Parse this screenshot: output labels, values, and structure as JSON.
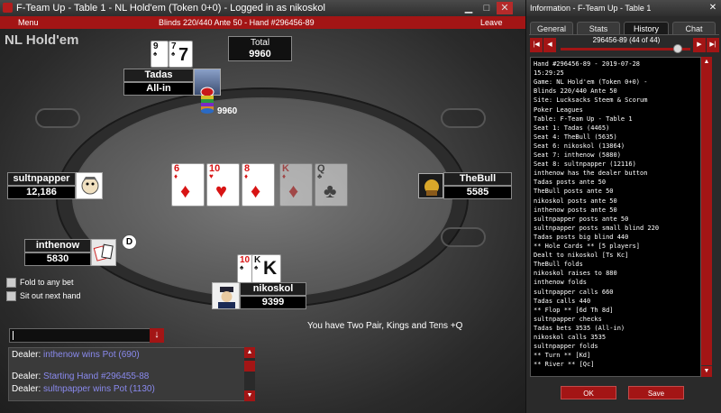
{
  "game_window": {
    "title": "F-Team Up - Table 1 - NL Hold'em (Token 0+0) - Logged in as nikoskol",
    "menu_label": "Menu",
    "blinds_text": "Blinds 220/440 Ante 50 - Hand #296456-89",
    "leave_label": "Leave",
    "game_name": "NL Hold'em"
  },
  "pot": {
    "label": "Total",
    "value": "9960"
  },
  "chip_stack_value": "9960",
  "dealer_button": "D",
  "board": [
    {
      "rank": "6",
      "suit": "♦",
      "color": "red",
      "dim": false
    },
    {
      "rank": "10",
      "suit": "♥",
      "color": "red",
      "dim": false
    },
    {
      "rank": "8",
      "suit": "♦",
      "color": "red",
      "dim": false
    },
    {
      "rank": "K",
      "suit": "♦",
      "color": "red",
      "dim": true
    },
    {
      "rank": "Q",
      "suit": "♣",
      "color": "black",
      "dim": true
    }
  ],
  "players": {
    "tadas": {
      "name": "Tadas",
      "stack": "All-in",
      "cards": [
        {
          "rank": "9",
          "suit": "♠"
        },
        {
          "rank": "7",
          "suit": "♠"
        }
      ]
    },
    "sultnpapper": {
      "name": "sultnpapper",
      "stack": "12,186"
    },
    "thebull": {
      "name": "TheBull",
      "stack": "5585"
    },
    "inthenow": {
      "name": "inthenow",
      "stack": "5830"
    },
    "nikoskol": {
      "name": "nikoskol",
      "stack": "9399",
      "cards": [
        {
          "rank": "10",
          "suit": "♠"
        },
        {
          "rank": "K",
          "suit": "♠"
        }
      ]
    }
  },
  "options": {
    "fold_to_any_bet": "Fold to any bet",
    "sit_out_next_hand": "Sit out next hand"
  },
  "hand_description": "You have Two Pair, Kings and Tens +Q",
  "chat": {
    "input_value": "",
    "log": [
      {
        "speaker": "Dealer:",
        "message": "inthenow wins Pot (690)"
      },
      {
        "speaker": "Dealer:",
        "message": "Starting Hand #296455-88"
      },
      {
        "speaker": "Dealer:",
        "message": "sultnpapper wins Pot (1130)"
      }
    ]
  },
  "info_panel": {
    "title": "Information - F-Team Up - Table 1",
    "tabs": [
      "General",
      "Stats",
      "History",
      "Chat"
    ],
    "active_tab": "History",
    "hand_counter": "296456-89 (44 of 44)",
    "slider_position": 0.9,
    "history_lines": [
      "Hand #296456-89 - 2019-07-28",
      "15:29:25",
      "Game: NL Hold'em (Token 0+0) -",
      "Blinds 220/440 Ante 50",
      "Site: Lucksacks Steem & Scorum",
      "Poker Leagues",
      "Table: F-Team Up - Table 1",
      "Seat 1: Tadas (4465)",
      "Seat 4: TheBull (5635)",
      "Seat 6: nikoskol (13864)",
      "Seat 7: inthenow (5880)",
      "Seat 8: sultnpapper (12116)",
      "inthenow has the dealer button",
      "Tadas posts ante 50",
      "TheBull posts ante 50",
      "nikoskol posts ante 50",
      "inthenow posts ante 50",
      "sultnpapper posts ante 50",
      "sultnpapper posts small blind 220",
      "Tadas posts big blind 440",
      "** Hole Cards ** [5 players]",
      "Dealt to nikoskol [Ts Kc]",
      "TheBull folds",
      "nikoskol raises to 880",
      "inthenow folds",
      "sultnpapper calls 660",
      "Tadas calls 440",
      "** Flop ** [6d Th 8d]",
      "sultnpapper checks",
      "Tadas bets 3535 (All-in)",
      "nikoskol calls 3535",
      "sultnpapper folds",
      "** Turn ** [Kd]",
      "** River ** [Qc]"
    ],
    "ok_label": "OK",
    "save_label": "Save"
  },
  "colors": {
    "accent_red": "#a31515",
    "felt_gray": "#5e5e5e",
    "history_bg": "#000000"
  }
}
